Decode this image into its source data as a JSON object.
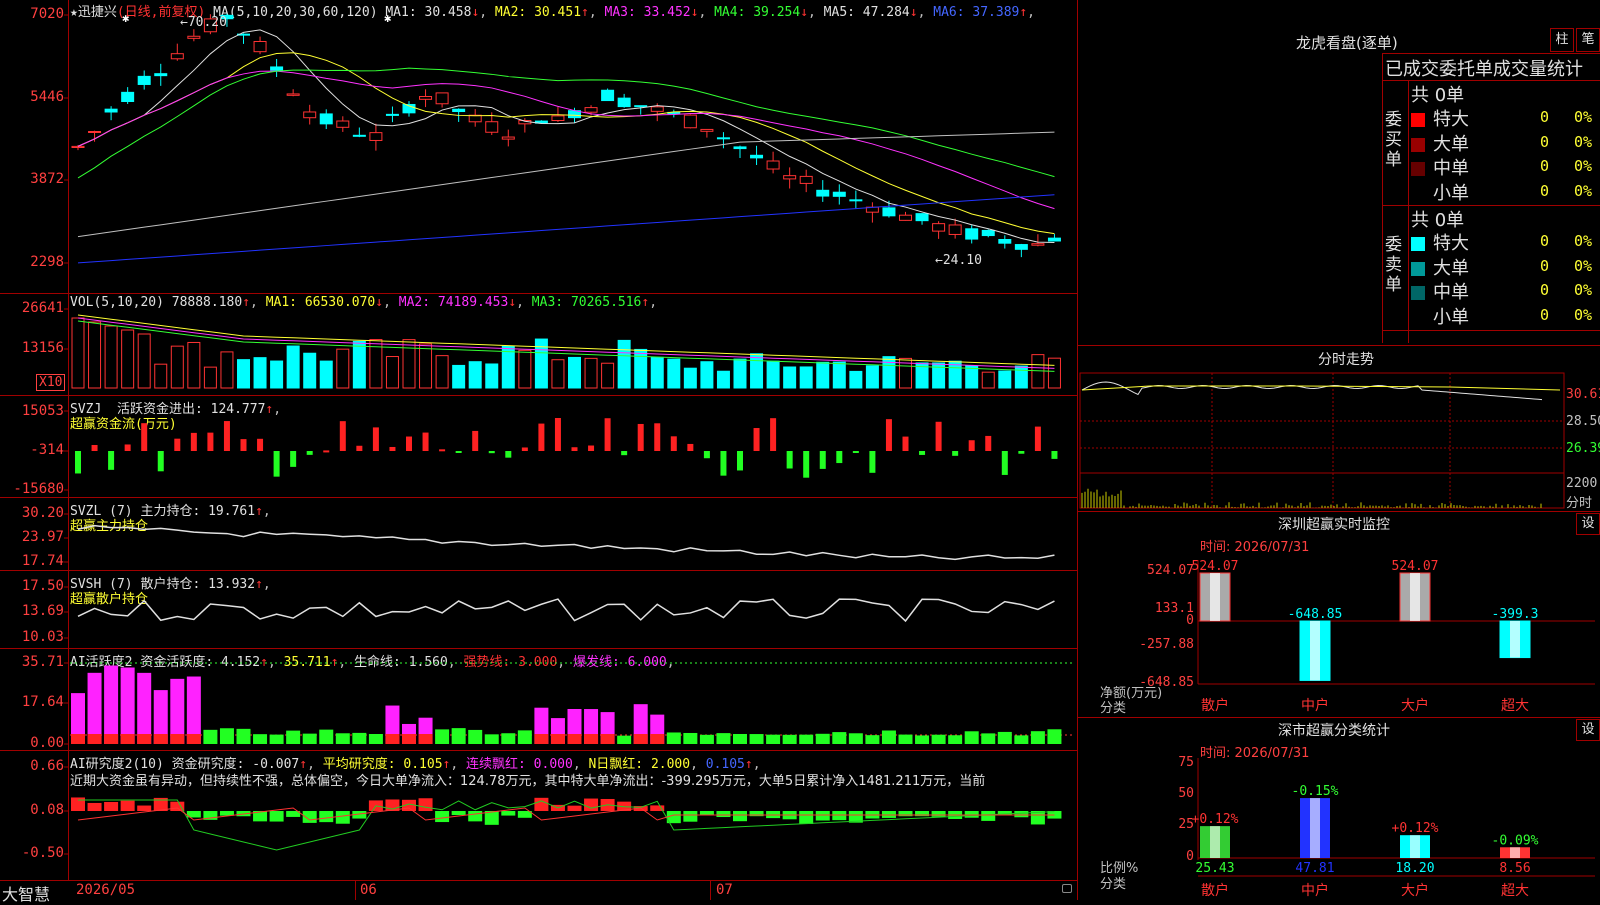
{
  "stock": {
    "name": "迅捷兴",
    "period": "(日线,前复权)"
  },
  "main_chart": {
    "ma_title": "MA(5,10,20,30,60,120)",
    "ma": [
      {
        "label": "MA1:",
        "value": "30.458",
        "arrow": "↓",
        "color": "#e0e0e0"
      },
      {
        "label": "MA2:",
        "value": "30.451",
        "arrow": "↑",
        "color": "#ffff33"
      },
      {
        "label": "MA3:",
        "value": "33.452",
        "arrow": "↓",
        "color": "#ff33ff"
      },
      {
        "label": "MA4:",
        "value": "39.254",
        "arrow": "↓",
        "color": "#33ff33"
      },
      {
        "label": "MA5:",
        "value": "47.284",
        "arrow": "↓",
        "color": "#e0e0e0"
      },
      {
        "label": "MA6:",
        "value": "37.389",
        "arrow": "↑",
        "color": "#4466ff"
      }
    ],
    "y_ticks": [
      "7020",
      "5446",
      "3872",
      "2298"
    ],
    "high_mark": "70.20",
    "low_mark": "24.10"
  },
  "volume": {
    "title": "VOL(5,10,20)",
    "value": "78888.180",
    "ma": [
      {
        "label": "MA1:",
        "value": "66530.070",
        "arrow": "↓",
        "color": "#ffff33"
      },
      {
        "label": "MA2:",
        "value": "74189.453",
        "arrow": "↓",
        "color": "#ff33ff"
      },
      {
        "label": "MA3:",
        "value": "70265.516",
        "arrow": "↑",
        "color": "#33ff33"
      }
    ],
    "y_ticks": [
      "26641",
      "13156"
    ],
    "unit": "X10"
  },
  "svzj": {
    "title": "SVZJ",
    "label": "活跃资金进出:",
    "value": "124.777",
    "sub": "超赢资金流(万元)",
    "y_ticks": [
      "15053",
      "-314",
      "-15680"
    ]
  },
  "svzl": {
    "title": "SVZL (7)",
    "label": "主力持仓:",
    "value": "19.761",
    "sub": "超赢主力持仓",
    "y_ticks": [
      "30.20",
      "23.97",
      "17.74"
    ]
  },
  "svsh": {
    "title": "SVSH (7)",
    "label": "散户持仓:",
    "value": "13.932",
    "sub": "超赢散户持仓",
    "y_ticks": [
      "17.50",
      "13.69",
      "10.03"
    ]
  },
  "ai_active": {
    "title": "AI活跃度2",
    "label": "资金活跃度:",
    "value": "4.152",
    "v2": "35.711",
    "life_label": "生命线:",
    "life": "1.560",
    "strong_label": "强势线:",
    "strong": "3.000",
    "burst_label": "爆发线:",
    "burst": "6.000",
    "y_ticks": [
      "35.71",
      "17.64",
      "0.00"
    ]
  },
  "ai_research": {
    "title": "AI研究度2(10)",
    "label": "资金研究度:",
    "value": "-0.007",
    "avg_label": "平均研究度:",
    "avg": "0.105",
    "cont_label": "连续飘红:",
    "cont": "0.000",
    "n_label": "N日飘红:",
    "n": "2.000",
    "v5": "0.105",
    "note": "近期大资金虽有异动，但持续性不强，总体偏空，今日大单净流入：124.78万元，其中特大单净流出：-399.295万元，大单5日累计净入1481.211万元，当前",
    "y_ticks": [
      "0.66",
      "0.08",
      "-0.50"
    ]
  },
  "x_axis": {
    "labels": [
      "2026/05",
      "06",
      "07"
    ]
  },
  "brand": "大智慧",
  "right_panel": {
    "dragon": {
      "title": "龙虎看盘(逐单)",
      "btn1": "柱",
      "btn2": "笔",
      "header": "已成交委托单成交量统计",
      "buy_side": "委买单",
      "sell_side": "委卖单",
      "buy_total": "共 0单",
      "sell_total": "共 0单",
      "buy_rows": [
        {
          "label": "特大",
          "count": "0",
          "pct": "0%",
          "color": "#ff0000"
        },
        {
          "label": "大单",
          "count": "0",
          "pct": "0%",
          "color": "#990000"
        },
        {
          "label": "中单",
          "count": "0",
          "pct": "0%",
          "color": "#660000"
        },
        {
          "label": "小单",
          "count": "0",
          "pct": "0%",
          "color": "#000000"
        }
      ],
      "sell_rows": [
        {
          "label": "特大",
          "count": "0",
          "pct": "0%",
          "color": "#00ffff"
        },
        {
          "label": "大单",
          "count": "0",
          "pct": "0%",
          "color": "#009999"
        },
        {
          "label": "中单",
          "count": "0",
          "pct": "0%",
          "color": "#006666"
        },
        {
          "label": "小单",
          "count": "0",
          "pct": "0%",
          "color": "#000000"
        }
      ]
    },
    "intraday": {
      "title": "分时走势",
      "y_ticks": [
        "30.61",
        "28.50",
        "26.39"
      ],
      "vol_tick": "2200",
      "vol_label": "分时"
    },
    "monitor": {
      "title": "深圳超赢实时监控",
      "btn": "设",
      "time": "时间: 2026/07/31",
      "y_ticks": [
        "524.07",
        "133.1",
        "0",
        "-257.88",
        "-648.85"
      ],
      "ylabel": "净额(万元)",
      "xlabel": "分类",
      "categories": [
        "散户",
        "中户",
        "大户",
        "超大"
      ],
      "values": [
        524.07,
        -648.85,
        524.07,
        -399.3
      ],
      "value_labels": [
        "524.07",
        "-648.85",
        "524.07",
        "-399.3"
      ]
    },
    "classify": {
      "title": "深市超赢分类统计",
      "btn": "设",
      "time": "时间: 2026/07/31",
      "y_ticks": [
        "75",
        "50",
        "25",
        "0"
      ],
      "ylabel": "比例%",
      "xlabel": "分类",
      "categories": [
        "散户",
        "中户",
        "大户",
        "超大"
      ],
      "values": [
        25.43,
        47.81,
        18.2,
        8.56
      ],
      "value_labels": [
        "25.43",
        "47.81",
        "18.20",
        "8.56"
      ],
      "changes": [
        "+0.12%",
        "-0.15%",
        "+0.12%",
        "-0.09%"
      ]
    }
  }
}
